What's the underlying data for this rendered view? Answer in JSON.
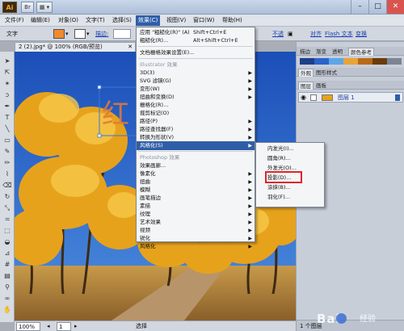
{
  "titlebar": {
    "logo": "Ai",
    "bridge_btn": "Br",
    "arrange_btn": "▦ ▾",
    "controls": [
      "–",
      "□",
      "✕"
    ]
  },
  "menubar": {
    "items": [
      {
        "label": "文件(F)"
      },
      {
        "label": "编辑(E)"
      },
      {
        "label": "对象(O)"
      },
      {
        "label": "文字(T)"
      },
      {
        "label": "选择(S)"
      },
      {
        "label": "效果(C)",
        "active": true
      },
      {
        "label": "视图(V)"
      },
      {
        "label": "窗口(W)"
      },
      {
        "label": "帮助(H)"
      }
    ]
  },
  "controlbar": {
    "text_label": "文字",
    "stroke_label": "描边:",
    "not_transparent": "不透",
    "align": "对齐",
    "flash_text": "Flash 文本",
    "transform": "变换",
    "fill_color": "#f08a2c"
  },
  "doc_tab": {
    "label": "2 (2).jpg* @ 100% (RGB/预览)",
    "close": "✕"
  },
  "canvas": {
    "overlay_text": "红 的"
  },
  "statusbar": {
    "zoom": "100%",
    "page": "1",
    "tool": "选择"
  },
  "effect_menu": {
    "items": [
      {
        "label": "应用 \"粗糙化(R)\" (A)",
        "shortcut": "Shift+Ctrl+E"
      },
      {
        "label": "粗糙化(R)...",
        "shortcut": "Alt+Shift+Ctrl+E"
      },
      {
        "sep": true
      },
      {
        "label": "文档栅格效果设置(E)..."
      },
      {
        "sep": true
      },
      {
        "label": "Illustrator 效果",
        "header": true
      },
      {
        "label": "3D(3)",
        "submenu": true
      },
      {
        "label": "SVG 滤镜(G)",
        "submenu": true
      },
      {
        "label": "变形(W)",
        "submenu": true
      },
      {
        "label": "扭曲和变换(D)",
        "submenu": true
      },
      {
        "label": "栅格化(R)..."
      },
      {
        "label": "裁剪标记(O)"
      },
      {
        "label": "路径(P)",
        "submenu": true
      },
      {
        "label": "路径查找器(F)",
        "submenu": true
      },
      {
        "label": "转换为形状(V)",
        "submenu": true
      },
      {
        "label": "风格化(S)",
        "submenu": true,
        "highlight": true
      },
      {
        "sep": true
      },
      {
        "label": "Photoshop 效果",
        "header": true
      },
      {
        "label": "效果画廊..."
      },
      {
        "label": "像素化",
        "submenu": true
      },
      {
        "label": "扭曲",
        "submenu": true
      },
      {
        "label": "模糊",
        "submenu": true
      },
      {
        "label": "画笔描边",
        "submenu": true
      },
      {
        "label": "素描",
        "submenu": true
      },
      {
        "label": "纹理",
        "submenu": true
      },
      {
        "label": "艺术效果",
        "submenu": true
      },
      {
        "label": "视频",
        "submenu": true
      },
      {
        "label": "锐化",
        "submenu": true
      },
      {
        "label": "风格化",
        "submenu": true
      }
    ]
  },
  "stylize_submenu": {
    "items": [
      "内发光(I)...",
      "圆角(R)...",
      "外发光(O)...",
      "投影(D)...",
      "涂抹(B)...",
      "羽化(F)..."
    ],
    "selected_index": 3
  },
  "right_panel": {
    "top_tabs": [
      "描边",
      "渐变",
      "透明",
      "颜色参考"
    ],
    "appearance_tabs": [
      "外观",
      "图形样式"
    ],
    "layer_tabs": [
      "图层",
      "画板"
    ],
    "layer_name": "图层 1",
    "layers_count": "1 个图层"
  },
  "watermark": {
    "text": "Bai",
    "sub": "经验"
  },
  "colors": {
    "menu_highlight": "#2f5ea8",
    "red_box": "#e0262a",
    "sky": "#2c67c8"
  }
}
